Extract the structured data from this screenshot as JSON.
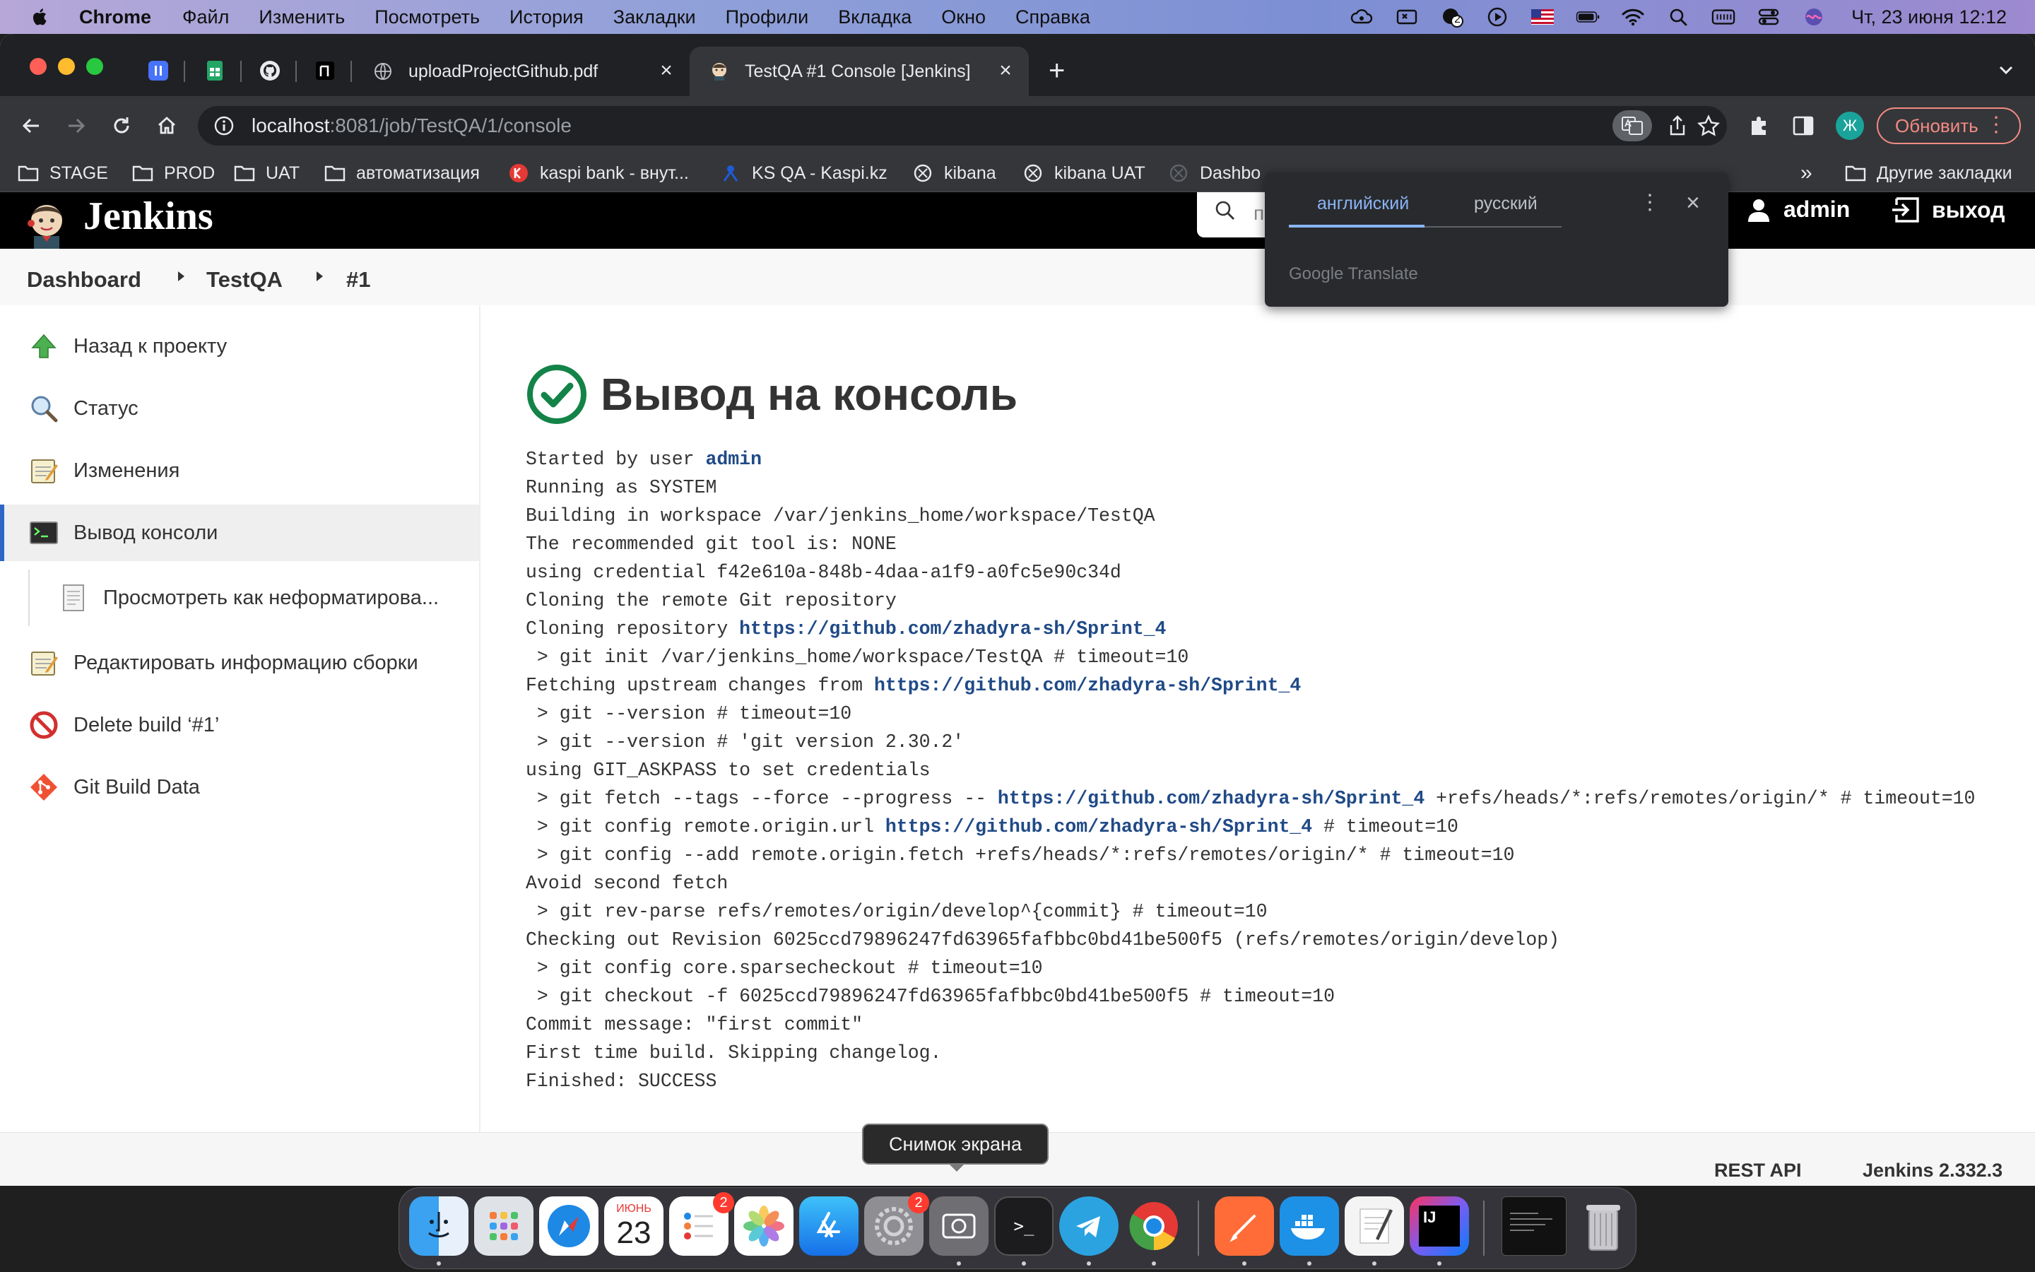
{
  "menubar": {
    "app_name": "Chrome",
    "items": [
      "Файл",
      "Изменить",
      "Посмотреть",
      "История",
      "Закладки",
      "Профили",
      "Вкладка",
      "Окно",
      "Справка"
    ],
    "clock": "Чт, 23 июня  12:12",
    "badge_count": "2"
  },
  "tabs": [
    {
      "title": "uploadProjectGithub.pdf",
      "active": false
    },
    {
      "title": "TestQA #1 Console [Jenkins]",
      "active": true
    }
  ],
  "toolbar": {
    "url_host": "localhost",
    "url_path": ":8081/job/TestQA/1/console",
    "profile_initial": "Ж",
    "update_label": "Обновить"
  },
  "bookmarks": {
    "items": [
      "STAGE",
      "PROD",
      "UAT",
      "автоматизация",
      "kaspi bank - внут...",
      "KS QA - Kaspi.kz",
      "kibana",
      "kibana UAT",
      "Dashbo"
    ],
    "more": "»",
    "other": "Другие закладки"
  },
  "jenkins": {
    "title": "Jenkins",
    "search_placeholder": "п",
    "user": "admin",
    "logout": "выход",
    "breadcrumbs": [
      "Dashboard",
      "TestQA",
      "#1"
    ],
    "sidebar": [
      {
        "label": "Назад к проекту",
        "icon": "arrow-up-icon"
      },
      {
        "label": "Статус",
        "icon": "magnifier-icon"
      },
      {
        "label": "Изменения",
        "icon": "notepad-icon"
      },
      {
        "label": "Вывод консоли",
        "icon": "terminal-icon"
      },
      {
        "label": "Просмотреть как неформатирова...",
        "icon": "document-icon"
      },
      {
        "label": "Редактировать информацию сборки",
        "icon": "notepad-icon"
      },
      {
        "label": "Delete build ‘#1’",
        "icon": "no-entry-icon"
      },
      {
        "label": "Git Build Data",
        "icon": "git-icon"
      }
    ],
    "heading": "Вывод на консоль",
    "console": [
      {
        "pre": "Started by user ",
        "link": "admin",
        "post": ""
      },
      {
        "pre": "Running as SYSTEM",
        "link": "",
        "post": ""
      },
      {
        "pre": "Building in workspace /var/jenkins_home/workspace/TestQA",
        "link": "",
        "post": ""
      },
      {
        "pre": "The recommended git tool is: NONE",
        "link": "",
        "post": ""
      },
      {
        "pre": "using credential f42e610a-848b-4daa-a1f9-a0fc5e90c34d",
        "link": "",
        "post": ""
      },
      {
        "pre": "Cloning the remote Git repository",
        "link": "",
        "post": ""
      },
      {
        "pre": "Cloning repository ",
        "link": "https://github.com/zhadyra-sh/Sprint_4",
        "post": ""
      },
      {
        "pre": " > git init /var/jenkins_home/workspace/TestQA # timeout=10",
        "link": "",
        "post": ""
      },
      {
        "pre": "Fetching upstream changes from ",
        "link": "https://github.com/zhadyra-sh/Sprint_4",
        "post": ""
      },
      {
        "pre": " > git --version # timeout=10",
        "link": "",
        "post": ""
      },
      {
        "pre": " > git --version # 'git version 2.30.2'",
        "link": "",
        "post": ""
      },
      {
        "pre": "using GIT_ASKPASS to set credentials",
        "link": "",
        "post": ""
      },
      {
        "pre": " > git fetch --tags --force --progress -- ",
        "link": "https://github.com/zhadyra-sh/Sprint_4",
        "post": " +refs/heads/*:refs/remotes/origin/* # timeout=10"
      },
      {
        "pre": " > git config remote.origin.url ",
        "link": "https://github.com/zhadyra-sh/Sprint_4",
        "post": " # timeout=10"
      },
      {
        "pre": " > git config --add remote.origin.fetch +refs/heads/*:refs/remotes/origin/* # timeout=10",
        "link": "",
        "post": ""
      },
      {
        "pre": "Avoid second fetch",
        "link": "",
        "post": ""
      },
      {
        "pre": " > git rev-parse refs/remotes/origin/develop^{commit} # timeout=10",
        "link": "",
        "post": ""
      },
      {
        "pre": "Checking out Revision 6025ccd79896247fd63965fafbbc0bd41be500f5 (refs/remotes/origin/develop)",
        "link": "",
        "post": ""
      },
      {
        "pre": " > git config core.sparsecheckout # timeout=10",
        "link": "",
        "post": ""
      },
      {
        "pre": " > git checkout -f 6025ccd79896247fd63965fafbbc0bd41be500f5 # timeout=10",
        "link": "",
        "post": ""
      },
      {
        "pre": "Commit message: \"first commit\"",
        "link": "",
        "post": ""
      },
      {
        "pre": "First time build. Skipping changelog.",
        "link": "",
        "post": ""
      },
      {
        "pre": "Finished: SUCCESS",
        "link": "",
        "post": ""
      }
    ],
    "footer": {
      "rest_api": "REST API",
      "version": "Jenkins 2.332.3"
    }
  },
  "translate": {
    "lang_from": "английский",
    "lang_to": "русский",
    "brand_google": "Google",
    "brand_translate": "Translate"
  },
  "tooltip": "Снимок экрана",
  "dock": {
    "calendar_month": "ИЮНЬ",
    "calendar_day": "23",
    "reminders_badge": "2",
    "settings_badge": "2",
    "intellij_label": "IJ",
    "terminal_prompt": ">_"
  },
  "colors": {
    "accent_link": "#204a87",
    "success_green": "#138347",
    "active_indicator": "#2e66c7",
    "update_red": "#f28b82"
  }
}
